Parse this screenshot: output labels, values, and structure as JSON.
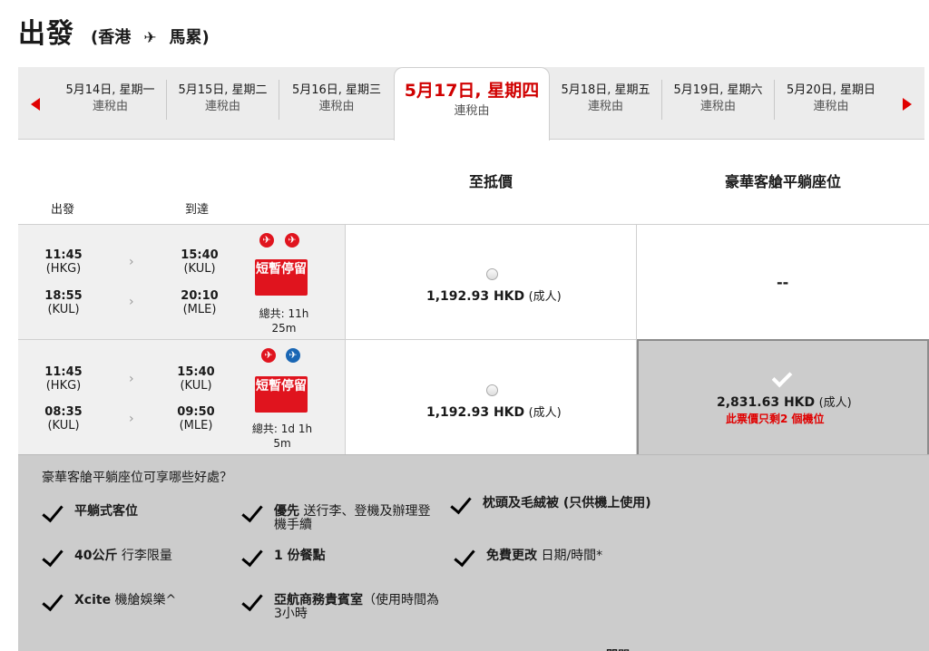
{
  "header": {
    "title": "出發",
    "origin": "(香港",
    "destination": "馬累)"
  },
  "dates": [
    {
      "date": "5月14日, 星期一",
      "sub": "連稅由"
    },
    {
      "date": "5月15日, 星期二",
      "sub": "連稅由"
    },
    {
      "date": "5月16日, 星期三",
      "sub": "連稅由"
    },
    {
      "date": "5月17日, 星期四",
      "sub": "連稅由"
    },
    {
      "date": "5月18日, 星期五",
      "sub": "連稅由"
    },
    {
      "date": "5月19日, 星期六",
      "sub": "連稅由"
    },
    {
      "date": "5月20日, 星期日",
      "sub": "連稅由"
    }
  ],
  "columns": {
    "depart": "出發",
    "arrive": "到達",
    "lowest": "至抵價",
    "premium": "豪華客艙平躺座位"
  },
  "flights": [
    {
      "seg1": {
        "dep_time": "11:45",
        "dep_ap": "(HKG)",
        "arr_time": "15:40",
        "arr_ap": "(KUL)"
      },
      "seg2": {
        "dep_time": "18:55",
        "dep_ap": "(KUL)",
        "arr_time": "20:10",
        "arr_ap": "(MLE)"
      },
      "stop": "短暫停留",
      "total_label": "總共: 11h",
      "total_rest": "25m",
      "lowest_amount": "1,192.93 HKD",
      "pax": "(成人)",
      "premium": "--"
    },
    {
      "seg1": {
        "dep_time": "11:45",
        "dep_ap": "(HKG)",
        "arr_time": "15:40",
        "arr_ap": "(KUL)"
      },
      "seg2": {
        "dep_time": "08:35",
        "dep_ap": "(KUL)",
        "arr_time": "09:50",
        "arr_ap": "(MLE)"
      },
      "stop": "短暫停留",
      "total_label": "總共: 1d 1h",
      "total_rest": "5m",
      "lowest_amount": "1,192.93 HKD",
      "pax": "(成人)",
      "premium_amount": "2,831.63 HKD",
      "premium_pax": "(成人)",
      "seats_left": "此票價只剩2 個機位"
    }
  ],
  "benefits": {
    "question": "豪華客艙平躺座位可享哪些好處？",
    "items": [
      {
        "bold": "平躺式客位",
        "rest": ""
      },
      {
        "bold": "優先",
        "rest": " 送行李、登機及辦理登機手續"
      },
      {
        "bold": "枕頭及毛絨被 (只供機上使用)",
        "rest": ""
      },
      {
        "bold": "40公斤",
        "rest": " 行李限量"
      },
      {
        "bold": "1 份餐點",
        "rest": ""
      },
      {
        "bold": "免費更改",
        "rest": " 日期/時間*"
      },
      {
        "bold": "Xcite",
        "rest": " 機艙娛樂^"
      },
      {
        "bold": "亞航商務貴賓室",
        "rest": "（使用時間為3小時"
      }
    ],
    "partial": "關閉"
  },
  "colors": {
    "accent": "#e0141e",
    "active_date": "#d00000",
    "panel": "#cccccc"
  },
  "icons": {
    "plane": "plane-icon",
    "prev": "arrow-left-icon",
    "next": "arrow-right-icon"
  }
}
